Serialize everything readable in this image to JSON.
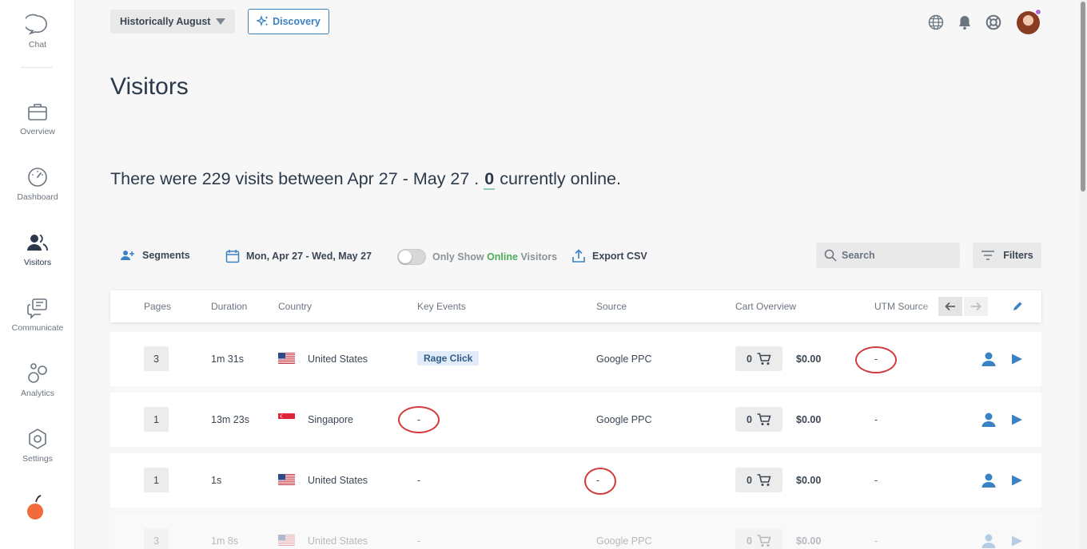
{
  "sidebar": {
    "items": [
      {
        "label": "Chat",
        "icon": "chat-bubble-icon"
      },
      {
        "label": "Overview",
        "icon": "briefcase-icon"
      },
      {
        "label": "Dashboard",
        "icon": "gauge-icon"
      },
      {
        "label": "Visitors",
        "icon": "users-icon"
      },
      {
        "label": "Communicate",
        "icon": "messages-icon"
      },
      {
        "label": "Analytics",
        "icon": "analytics-circles-icon"
      },
      {
        "label": "Settings",
        "icon": "hexagon-gear-icon"
      }
    ],
    "logo": "peach-logo"
  },
  "header": {
    "period": "Historically August",
    "discovery_label": "Discovery",
    "icons": [
      "globe-icon",
      "bell-icon",
      "lifebuoy-icon",
      "avatar"
    ]
  },
  "page": {
    "title": "Visitors",
    "summary_prefix": "There were 229 visits between Apr 27 - May 27 . ",
    "online_count": "0",
    "summary_suffix": " currently online."
  },
  "toolbar": {
    "segments_label": "Segments",
    "date_range": "Mon, Apr 27 - Wed, May 27",
    "toggle_prefix": "Only Show ",
    "toggle_highlight": "Online",
    "toggle_suffix": " Visitors",
    "export_label": "Export CSV",
    "search_placeholder": "Search",
    "filters_label": "Filters"
  },
  "table": {
    "columns": [
      "Pages",
      "Duration",
      "Country",
      "Key Events",
      "Source",
      "Cart Overview",
      "UTM Source"
    ],
    "rows": [
      {
        "pages": "3",
        "duration": "1m 31s",
        "country": "United States",
        "flag": "us",
        "key_events": "Rage Click",
        "source": "Google PPC",
        "cart_count": "0",
        "cart_value": "$0.00",
        "utm": "-"
      },
      {
        "pages": "1",
        "duration": "13m 23s",
        "country": "Singapore",
        "flag": "sg",
        "key_events": "-",
        "source": "Google PPC",
        "cart_count": "0",
        "cart_value": "$0.00",
        "utm": "-"
      },
      {
        "pages": "1",
        "duration": "1s",
        "country": "United States",
        "flag": "us",
        "key_events": "-",
        "source": "-",
        "cart_count": "0",
        "cart_value": "$0.00",
        "utm": "-"
      },
      {
        "pages": "3",
        "duration": "1m 8s",
        "country": "United States",
        "flag": "us",
        "key_events": "-",
        "source": "Google PPC",
        "cart_count": "0",
        "cart_value": "$0.00",
        "utm": "-"
      }
    ]
  },
  "colors": {
    "accent": "#3b82c4",
    "online_green": "#4cae58",
    "annotation_red": "#d33a3a",
    "logo_orange": "#f26b3a"
  }
}
